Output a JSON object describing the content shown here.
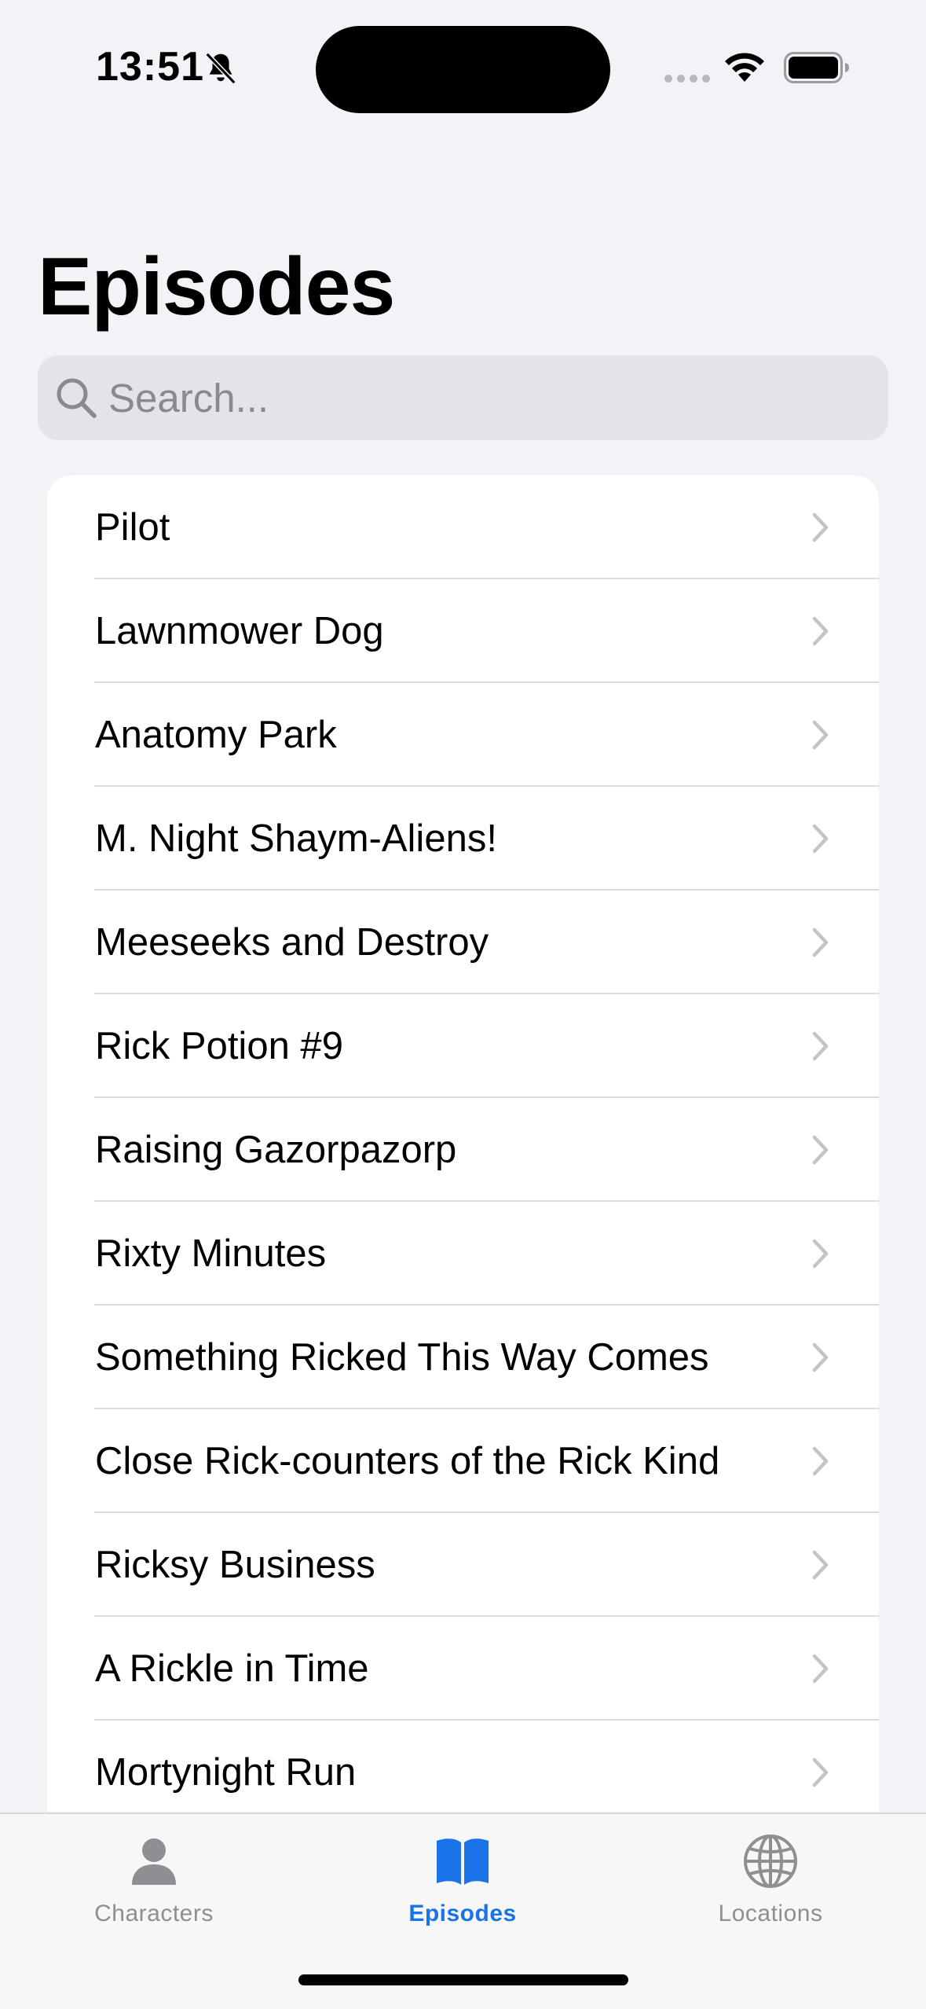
{
  "status_bar": {
    "time": "13:51",
    "icons": [
      "bell-slash-icon",
      "signal-icon",
      "wifi-icon",
      "battery-icon"
    ]
  },
  "header": {
    "title": "Episodes"
  },
  "search": {
    "placeholder": "Search...",
    "value": "",
    "icon": "search-icon"
  },
  "episodes": [
    {
      "label": "Pilot"
    },
    {
      "label": "Lawnmower Dog"
    },
    {
      "label": "Anatomy Park"
    },
    {
      "label": "M. Night Shaym-Aliens!"
    },
    {
      "label": "Meeseeks and Destroy"
    },
    {
      "label": "Rick Potion #9"
    },
    {
      "label": "Raising Gazorpazorp"
    },
    {
      "label": "Rixty Minutes"
    },
    {
      "label": "Something Ricked This Way Comes"
    },
    {
      "label": "Close Rick-counters of the Rick Kind"
    },
    {
      "label": "Ricksy Business"
    },
    {
      "label": "A Rickle in Time"
    },
    {
      "label": "Mortynight Run"
    }
  ],
  "tab_bar": {
    "tabs": [
      {
        "label": "Characters",
        "icon": "person-icon",
        "active": false
      },
      {
        "label": "Episodes",
        "icon": "book-icon",
        "active": true
      },
      {
        "label": "Locations",
        "icon": "globe-icon",
        "active": false
      }
    ]
  },
  "colors": {
    "accent": "#1a73e8",
    "inactive": "#8e8e93",
    "background": "#f2f2f7"
  }
}
